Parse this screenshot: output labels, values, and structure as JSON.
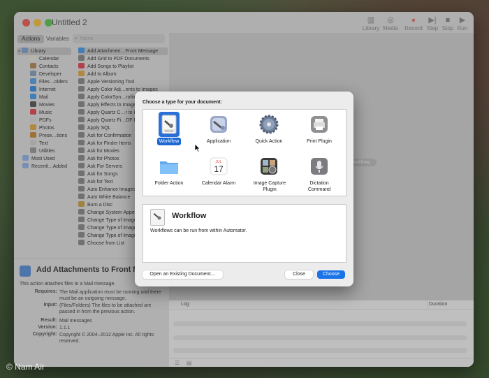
{
  "window": {
    "title": "Untitled 2",
    "toolbar": [
      {
        "label": "Library",
        "icon": "library-icon"
      },
      {
        "label": "Media",
        "icon": "media-icon"
      },
      {
        "label": "Record",
        "icon": "record-icon"
      },
      {
        "label": "Step",
        "icon": "step-icon"
      },
      {
        "label": "Stop",
        "icon": "stop-icon"
      },
      {
        "label": "Run",
        "icon": "run-icon"
      }
    ]
  },
  "sidebar": {
    "tabs": [
      "Actions",
      "Variables"
    ],
    "active_tab": "Actions",
    "search_placeholder": "Name",
    "library": [
      {
        "label": "Library",
        "icon": "library-folder-icon",
        "selected": true
      },
      {
        "label": "Calendar",
        "icon": "calendar-icon"
      },
      {
        "label": "Contacts",
        "icon": "contacts-icon"
      },
      {
        "label": "Developer",
        "icon": "developer-icon"
      },
      {
        "label": "Files…olders",
        "icon": "finder-icon"
      },
      {
        "label": "Internet",
        "icon": "internet-icon"
      },
      {
        "label": "Mail",
        "icon": "mail-icon"
      },
      {
        "label": "Movies",
        "icon": "movies-icon"
      },
      {
        "label": "Music",
        "icon": "music-icon"
      },
      {
        "label": "PDFs",
        "icon": "pdf-icon"
      },
      {
        "label": "Photos",
        "icon": "photos-icon"
      },
      {
        "label": "Prese…tions",
        "icon": "presentations-icon"
      },
      {
        "label": "Text",
        "icon": "text-icon"
      },
      {
        "label": "Utilities",
        "icon": "utilities-icon"
      },
      {
        "label": "Most Used",
        "icon": "folder-icon"
      },
      {
        "label": "Recentl…Added",
        "icon": "folder-icon"
      }
    ],
    "actions": [
      "Add Attachmen…Front Message",
      "Add Grid to PDF Documents",
      "Add Songs to Playlist",
      "Add to Album",
      "Apple Versioning Tool",
      "Apply Color Adj…ents to Images",
      "Apply ColorSyn…rofile to Images",
      "Apply Effects to Images",
      "Apply Quartz C…r to Images",
      "Apply Quartz Fi…DF Documents",
      "Apply SQL",
      "Ask for Confirmation",
      "Ask for Finder Items",
      "Ask for Movies",
      "Ask for Photos",
      "Ask For Servers",
      "Ask for Songs",
      "Ask for Text",
      "Auto Enhance Images",
      "Auto White Balance",
      "Burn a Disc",
      "Change System Appearance",
      "Change Type of Images",
      "Change Type of Images",
      "Change Type of Images",
      "Choose from List"
    ]
  },
  "description": {
    "title": "Add Attachments to Front Message",
    "summary": "This action attaches files to a Mail message.",
    "rows": [
      {
        "key": "Requires:",
        "value": "The Mail application must be running and there must be an outgoing message."
      },
      {
        "key": "Input:",
        "value": "(Files/Folders) The files to be attached are passed in from the previous action."
      },
      {
        "key": "Result:",
        "value": "Mail messages"
      },
      {
        "key": "Version:",
        "value": "1.1.1"
      },
      {
        "key": "Copyright:",
        "value": "Copyright © 2004–2012 Apple Inc.  All rights reserved."
      }
    ]
  },
  "workflow_area": {
    "hint": "workflow.",
    "log_columns": [
      "Log",
      "Duration"
    ]
  },
  "dialog": {
    "title": "Choose a type for your document:",
    "types": [
      {
        "label": "Workflow",
        "icon": "workflow-icon",
        "selected": true
      },
      {
        "label": "Application",
        "icon": "application-icon"
      },
      {
        "label": "Quick Action",
        "icon": "quick-action-icon"
      },
      {
        "label": "Print Plugin",
        "icon": "print-plugin-icon"
      },
      {
        "label": "Folder Action",
        "icon": "folder-action-icon"
      },
      {
        "label": "Calendar Alarm",
        "icon": "calendar-alarm-icon",
        "month": "JUL",
        "day": "17"
      },
      {
        "label": "Image Capture Plugin",
        "icon": "image-capture-plugin-icon"
      },
      {
        "label": "Dictation Command",
        "icon": "dictation-command-icon"
      }
    ],
    "icon_caption": "WFLOW",
    "preview": {
      "title": "Workflow",
      "description": "Workflows can be run from within Automator."
    },
    "buttons": {
      "open_existing": "Open an Existing Document…",
      "close": "Close",
      "choose": "Choose"
    }
  },
  "watermark": "© Nam Air",
  "colors": {
    "accent": "#1a74e8",
    "selection": "#1b67d6",
    "traffic_red": "#ec5f56",
    "traffic_yellow": "#f4be42",
    "traffic_green": "#5fc454"
  }
}
